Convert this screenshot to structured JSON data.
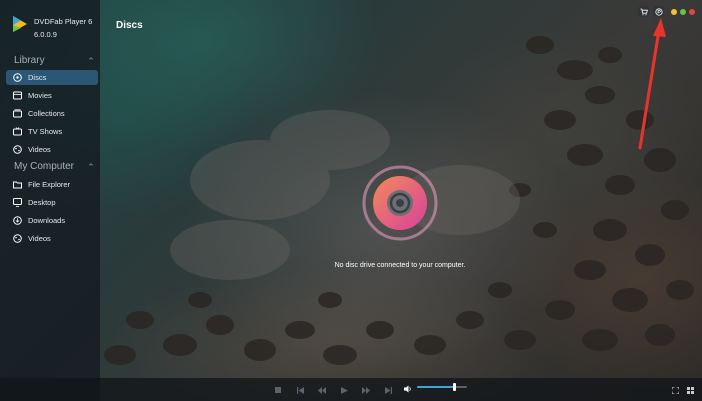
{
  "app": {
    "name": "DVDFab Player 6",
    "version": "6.0.0.9"
  },
  "page_title": "Discs",
  "sidebar": {
    "library_label": "Library",
    "library_items": [
      {
        "label": "Discs",
        "icon": "disc-icon",
        "active": true
      },
      {
        "label": "Movies",
        "icon": "film-icon",
        "active": false
      },
      {
        "label": "Collections",
        "icon": "collections-icon",
        "active": false
      },
      {
        "label": "TV Shows",
        "icon": "tv-icon",
        "active": false
      },
      {
        "label": "Videos",
        "icon": "video-icon",
        "active": false
      }
    ],
    "computer_label": "My Computer",
    "computer_items": [
      {
        "label": "File Explorer",
        "icon": "folder-icon"
      },
      {
        "label": "Desktop",
        "icon": "desktop-icon"
      },
      {
        "label": "Downloads",
        "icon": "download-icon"
      },
      {
        "label": "Videos",
        "icon": "video-icon"
      }
    ]
  },
  "main": {
    "message": "No disc drive connected to your computer."
  },
  "player": {
    "volume": 0.75
  },
  "colors": {
    "accent": "#3aa7d8",
    "disc_pink": "#e04f9a",
    "disc_orange": "#f28a5a",
    "arrow_red": "#e8342c"
  }
}
